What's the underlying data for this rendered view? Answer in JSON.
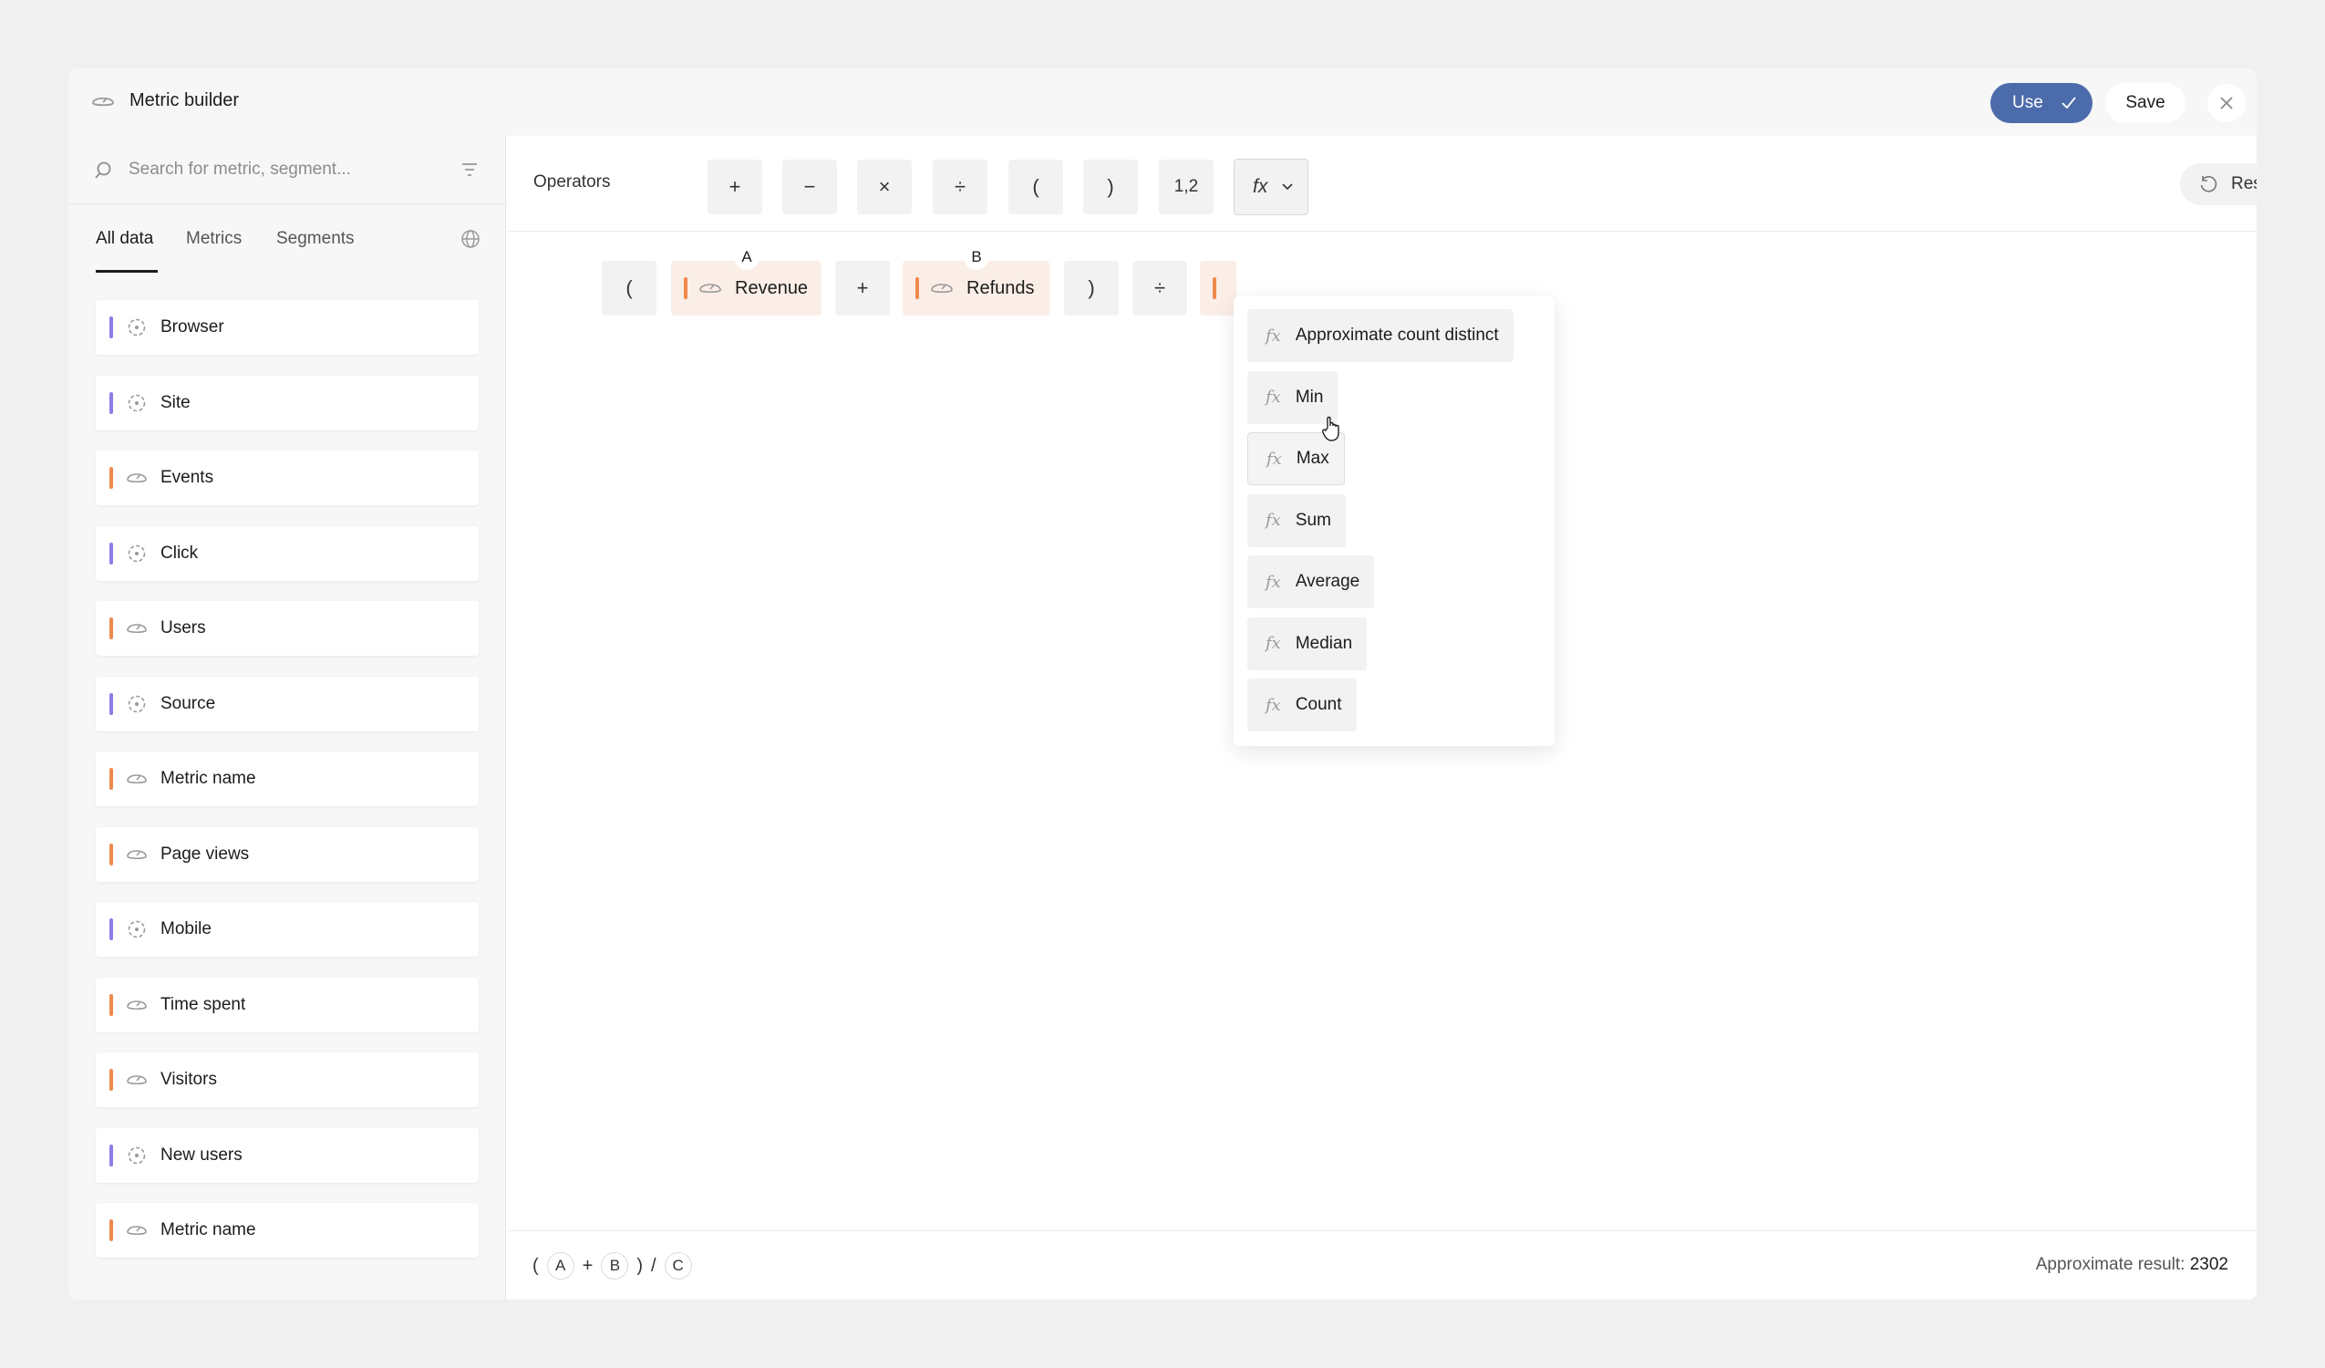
{
  "window": {
    "title": "Metric builder",
    "use_label": "Use",
    "save_label": "Save"
  },
  "sidebar": {
    "search_placeholder": "Search for metric, segment...",
    "tabs": [
      "All data",
      "Metrics",
      "Segments"
    ],
    "active_tab": "All data",
    "items": [
      {
        "label": "Browser",
        "kind": "segment",
        "color": "#8b7de8"
      },
      {
        "label": "Site",
        "kind": "segment",
        "color": "#8b7de8"
      },
      {
        "label": "Events",
        "kind": "metric",
        "color": "#f0894d"
      },
      {
        "label": "Click",
        "kind": "segment",
        "color": "#8b7de8"
      },
      {
        "label": "Users",
        "kind": "metric",
        "color": "#f0894d"
      },
      {
        "label": "Source",
        "kind": "segment",
        "color": "#8b7de8"
      },
      {
        "label": "Metric name",
        "kind": "metric",
        "color": "#f0894d"
      },
      {
        "label": "Page views",
        "kind": "metric",
        "color": "#f0894d"
      },
      {
        "label": "Mobile",
        "kind": "segment",
        "color": "#8b7de8"
      },
      {
        "label": "Time spent",
        "kind": "metric",
        "color": "#f0894d"
      },
      {
        "label": "Visitors",
        "kind": "metric",
        "color": "#f0894d"
      },
      {
        "label": "New users",
        "kind": "segment",
        "color": "#8b7de8"
      },
      {
        "label": "Metric name",
        "kind": "metric",
        "color": "#f0894d"
      }
    ]
  },
  "operators": {
    "label": "Operators",
    "buttons": [
      "+",
      "−",
      "×",
      "÷",
      "(",
      ")",
      "1,2"
    ],
    "fx_label": "fx",
    "reset_label": "Reset"
  },
  "expression": {
    "open_paren": "(",
    "metric_a": {
      "letter": "A",
      "label": "Revenue"
    },
    "plus": "+",
    "metric_b": {
      "letter": "B",
      "label": "Refunds"
    },
    "close_paren": ")",
    "divide": "÷"
  },
  "functions_menu": {
    "prefix": "fx",
    "items": [
      "Approximate count distinct",
      "Min",
      "Max",
      "Sum",
      "Average",
      "Median",
      "Count"
    ],
    "hovered": "Max"
  },
  "footer": {
    "formula": [
      "(",
      "A",
      "+",
      "B",
      ")",
      "/",
      "C"
    ],
    "approx_label": "Approximate result:",
    "approx_value": "2302"
  },
  "colors": {
    "accent": "#4c6bab",
    "metric": "#f0894d",
    "segment": "#8b7de8"
  }
}
